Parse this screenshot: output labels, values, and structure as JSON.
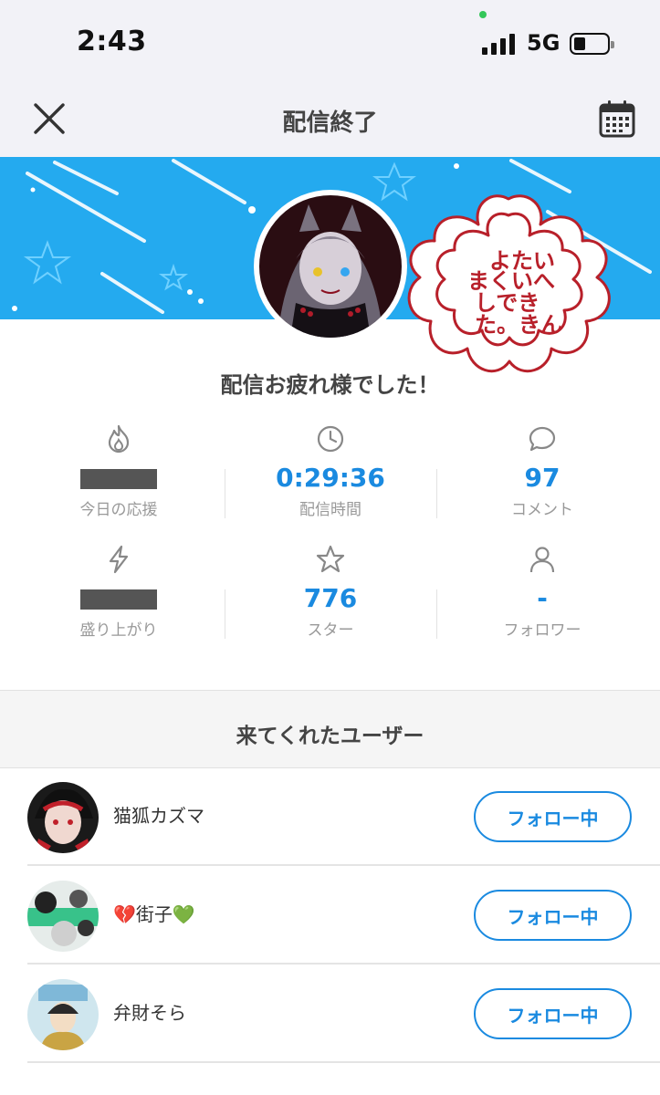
{
  "status_bar": {
    "time": "2:43",
    "network": "5G"
  },
  "nav": {
    "title": "配信終了",
    "close_icon": "close-icon",
    "calendar_icon": "calendar-icon"
  },
  "profile": {
    "thanks_text": "配信お疲れ様でした！"
  },
  "stamp": {
    "text_lines": [
      "よたい",
      "まくいへ",
      "しでき",
      "た。きん"
    ]
  },
  "stats": [
    {
      "icon": "flame-icon",
      "value": "",
      "redacted": true,
      "label": "今日の応援"
    },
    {
      "icon": "clock-icon",
      "value": "0:29:36",
      "label": "配信時間"
    },
    {
      "icon": "comment-icon",
      "value": "97",
      "label": "コメント"
    },
    {
      "icon": "lightning-icon",
      "value": "",
      "redacted": true,
      "label": "盛り上がり"
    },
    {
      "icon": "star-icon",
      "value": "776",
      "label": "スター"
    },
    {
      "icon": "person-icon",
      "value": "-",
      "label": "フォロワー"
    }
  ],
  "visitors": {
    "title": "来てくれたユーザー",
    "users": [
      {
        "name": "猫狐カズマ",
        "button": "フォロー中"
      },
      {
        "name": "💔街子💚",
        "button": "フォロー中"
      },
      {
        "name": "弁財そら",
        "button": "フォロー中"
      }
    ]
  },
  "colors": {
    "accent": "#1a8ae0",
    "banner": "#24aaef",
    "stamp": "#b8202a"
  }
}
